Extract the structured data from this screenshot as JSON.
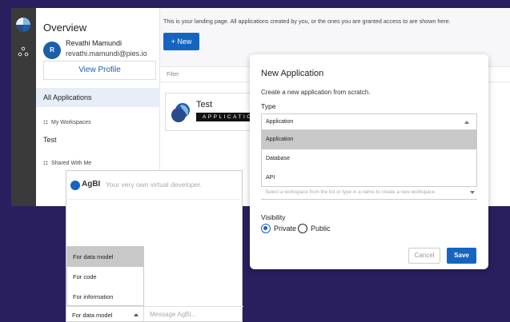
{
  "sidebar": {
    "title": "Overview",
    "user": {
      "initial": "R",
      "name": "Revathi Mamundi",
      "email": "revathi.mamundi@pies.io"
    },
    "profile_label": "View Profile",
    "all_applications": "All Applications",
    "my_workspaces": "My Workspaces",
    "workspace_item": "Test",
    "shared_with_me": "Shared With Me"
  },
  "main": {
    "landing_text": "This is your landing page. All applications created by you, or the ones you are granted access to are shown here.",
    "new_label": "+ New",
    "filter_placeholder": "Filter",
    "app_card": {
      "name": "Test",
      "badge": "APPLICATION"
    }
  },
  "agbi": {
    "name": "AgBI",
    "tagline": "Your very own virtual developer.",
    "menu_items": [
      "For data model",
      "For code",
      "For information"
    ],
    "selected_mode": "For data model",
    "message_placeholder": "Message AgBI..."
  },
  "dialog": {
    "title": "New Application",
    "subtitle": "Create a new application from scratch.",
    "type_label": "Type",
    "type_value": "Application",
    "type_options": [
      "Application",
      "Database",
      "API"
    ],
    "workspace_placeholder": "Select a workspace from the list or type in a name to create a new workspace",
    "visibility_label": "Visibility",
    "visibility_options": [
      "Private",
      "Public"
    ],
    "visibility_selected": "Private",
    "cancel_label": "Cancel",
    "save_label": "Save"
  },
  "colors": {
    "accent": "#1565c0",
    "background": "#2a1f5e",
    "rail": "#3a3a3a"
  }
}
